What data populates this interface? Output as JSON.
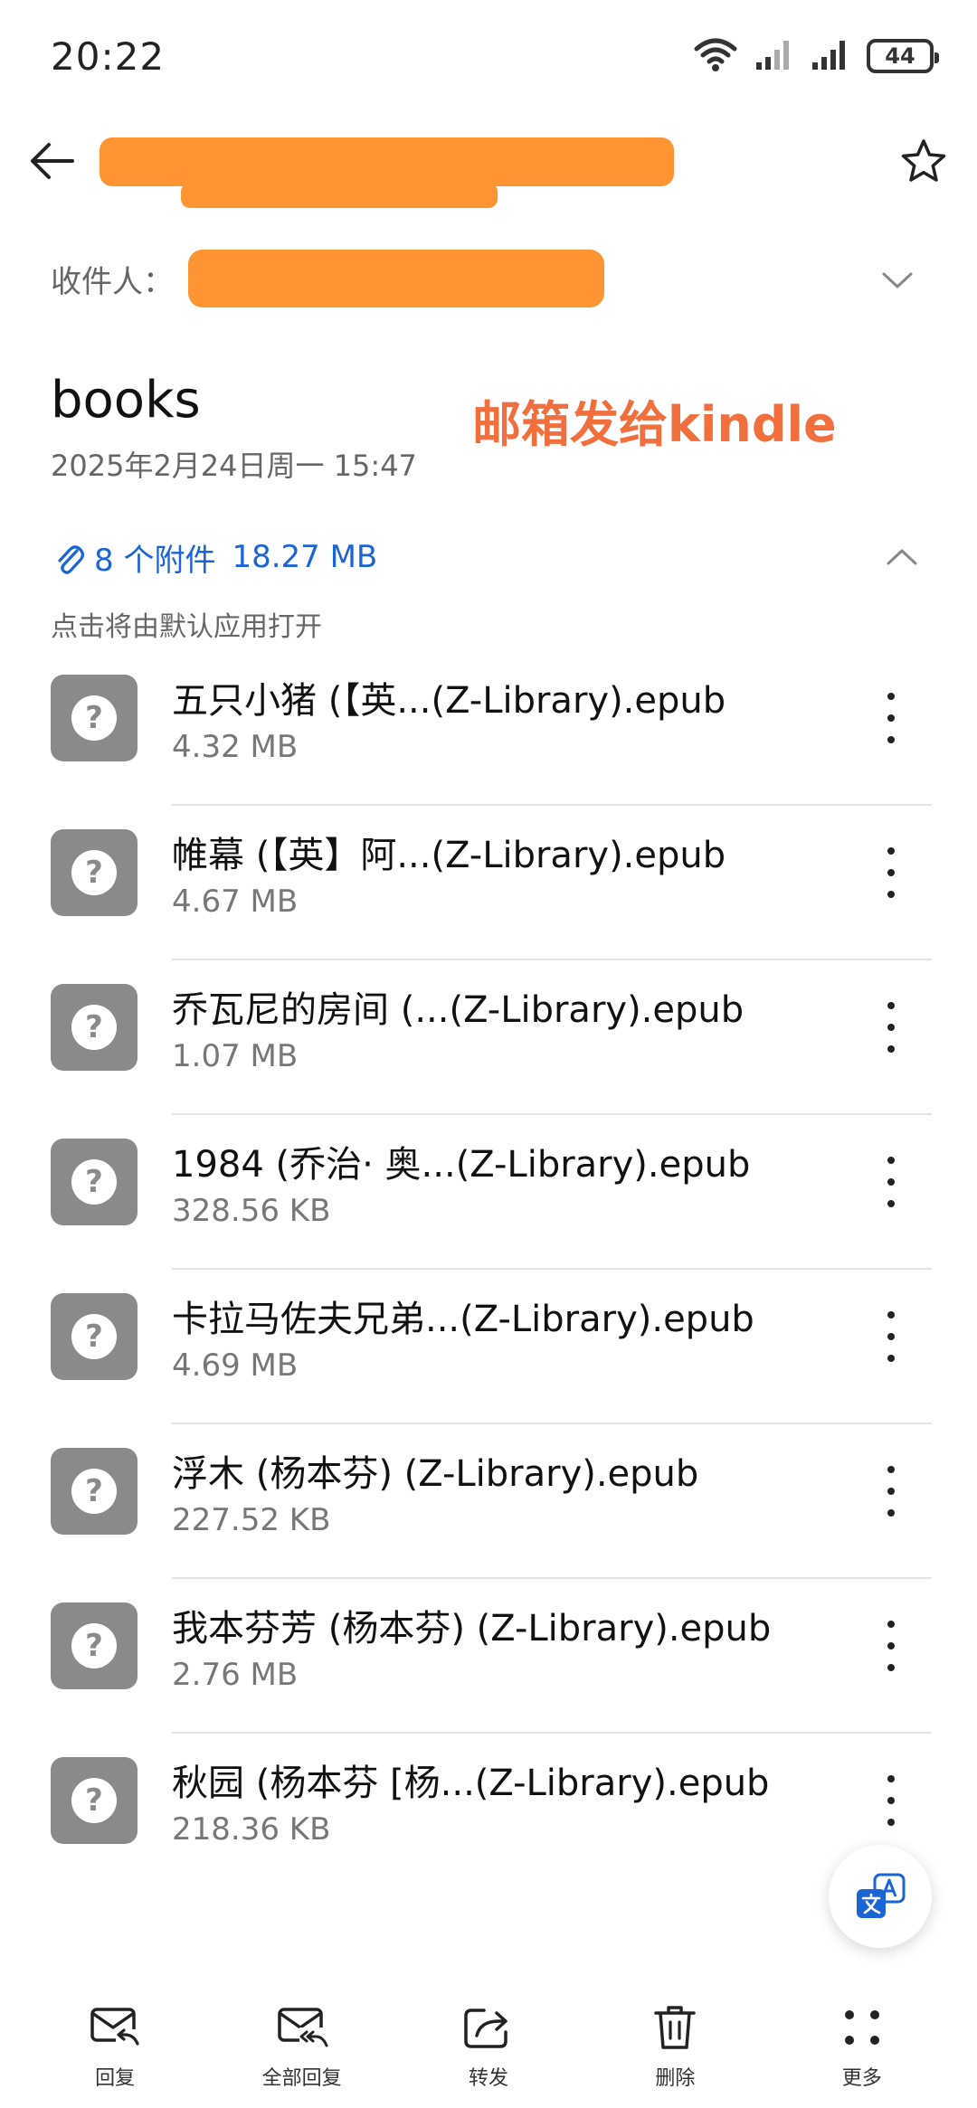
{
  "status_bar": {
    "time": "20:22",
    "battery": "44"
  },
  "recipient": {
    "label": "收件人："
  },
  "mail": {
    "title": "books",
    "annotation": "邮箱发给kindle",
    "date": "2025年2月24日周一 15:47"
  },
  "attachments": {
    "count_label": "8 个附件",
    "total_size": "18.27 MB",
    "hint": "点击将由默认应用打开",
    "files": [
      {
        "name": "五只小猪 (【英...(Z-Library).epub",
        "size": "4.32 MB"
      },
      {
        "name": "帷幕 (【英】阿...(Z-Library).epub",
        "size": "4.67 MB"
      },
      {
        "name": "乔瓦尼的房间 (...(Z-Library).epub",
        "size": "1.07 MB"
      },
      {
        "name": "1984 (乔治· 奥...(Z-Library).epub",
        "size": "328.56 KB"
      },
      {
        "name": "卡拉马佐夫兄弟...(Z-Library).epub",
        "size": "4.69 MB"
      },
      {
        "name": "浮木 (杨本芬) (Z-Library).epub",
        "size": "227.52 KB"
      },
      {
        "name": "我本芬芳 (杨本芬) (Z-Library).epub",
        "size": "2.76 MB"
      },
      {
        "name": "秋园 (杨本芬 [杨...(Z-Library).epub",
        "size": "218.36 KB"
      }
    ]
  },
  "bottom_bar": {
    "reply": "回复",
    "reply_all": "全部回复",
    "forward": "转发",
    "delete": "删除",
    "more": "更多"
  },
  "colors": {
    "accent": "#1a64d6",
    "redaction": "#ff9433",
    "annotation": "#f06f3d"
  }
}
